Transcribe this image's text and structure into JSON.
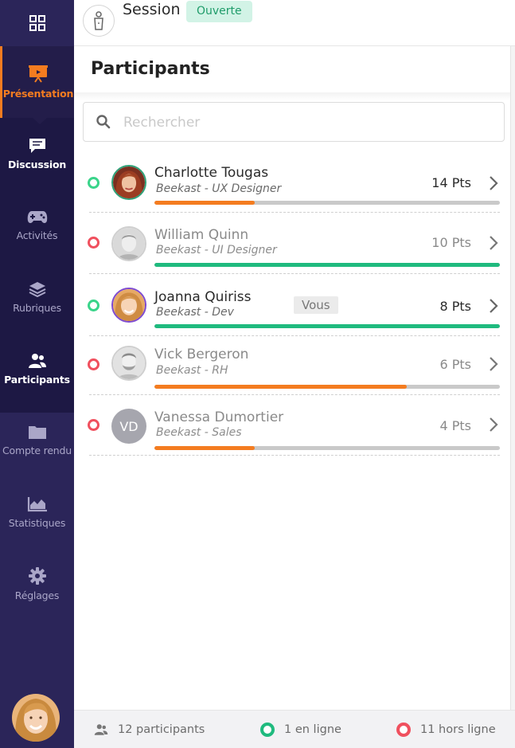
{
  "sidebar": {
    "items": [
      {
        "label": "Présentation",
        "icon": "presentation-icon"
      },
      {
        "label": "Discussion",
        "icon": "chat-icon"
      },
      {
        "label": "Activités",
        "icon": "gamepad-icon"
      },
      {
        "label": "Rubriques",
        "icon": "layers-icon"
      },
      {
        "label": "Participants",
        "icon": "users-icon"
      },
      {
        "label": "Compte rendu",
        "icon": "folder-icon"
      },
      {
        "label": "Statistiques",
        "icon": "chart-icon"
      },
      {
        "label": "Réglages",
        "icon": "gear-icon"
      }
    ],
    "active": "Présentation"
  },
  "header": {
    "title": "Session",
    "status": "Ouverte"
  },
  "panel": {
    "title": "Participants",
    "search_placeholder": "Rechercher"
  },
  "participants": [
    {
      "name": "Charlotte Tougas",
      "role": "Beekast - UX Designer",
      "points": "14 Pts",
      "online": true,
      "progress": 0.29,
      "bar_color": "#f47c20",
      "avatar": "photo"
    },
    {
      "name": "William Quinn",
      "role": "Beekast - UI Designer",
      "points": "10 Pts",
      "online": false,
      "progress": 1.0,
      "bar_color": "#1fba7e",
      "avatar": "photo"
    },
    {
      "name": "Joanna Quiriss",
      "role": "Beekast - Dev",
      "points": "8 Pts",
      "online": true,
      "progress": 1.0,
      "bar_color": "#1fba7e",
      "avatar": "photo",
      "tag": "Vous"
    },
    {
      "name": "Vick Bergeron",
      "role": "Beekast - RH",
      "points": "6 Pts",
      "online": false,
      "progress": 0.73,
      "bar_color": "#f47c20",
      "avatar": "photo"
    },
    {
      "name": "Vanessa Dumortier",
      "role": "Beekast - Sales",
      "points": "4 Pts",
      "online": false,
      "progress": 0.29,
      "bar_color": "#f47c20",
      "avatar": "VD"
    }
  ],
  "footer": {
    "total": "12 participants",
    "online": "1 en ligne",
    "offline": "11 hors ligne"
  },
  "colors": {
    "sidebar_bg": "#2b2559",
    "accent": "#f47c20",
    "online": "#3ad48a",
    "offline": "#f0505e",
    "progress_green": "#1fba7e"
  }
}
